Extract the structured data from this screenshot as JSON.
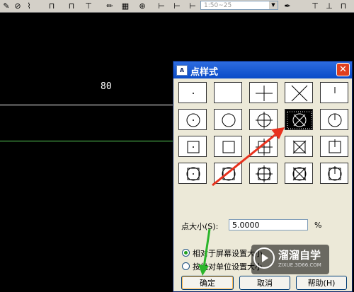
{
  "toolbar": {
    "scale_combo": "1:50~25"
  },
  "drawing": {
    "dimension_text": "80"
  },
  "dialog": {
    "title": "点样式",
    "icon_text": "A",
    "close_glyph": "✕",
    "point_size_label": "点大小(S):",
    "point_size_value": "5.0000",
    "percent_sign": "%",
    "radio_relative": "相对于屏幕设置大小",
    "radio_absolute": "按绝对单位设置大小",
    "ok_label": "确定",
    "cancel_label": "取消",
    "help_label": "帮助(H)",
    "selected_style_index": 8
  },
  "watermark": {
    "line1": "溜溜自学",
    "line2": "ZIXUE.3D66.COM"
  },
  "colors": {
    "titlebar": "#0a4bc8",
    "close": "#e0401f",
    "arrow_red": "#e8321e",
    "arrow_green": "#2bb52b",
    "dim_line": "#ffffff",
    "green_line": "#5bd75b"
  }
}
